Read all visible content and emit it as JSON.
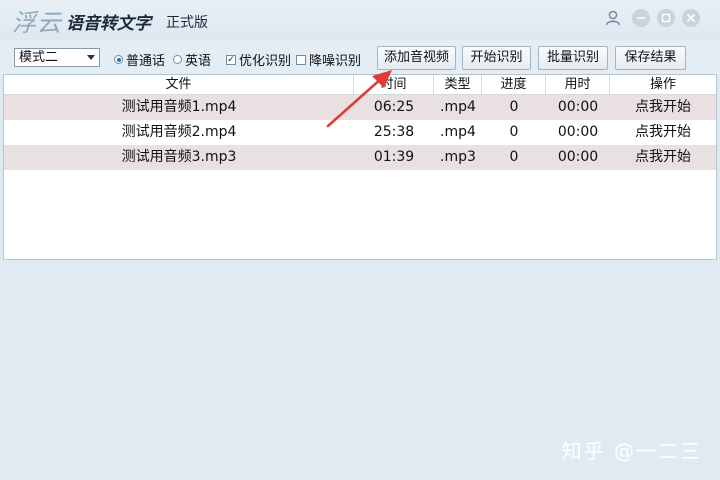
{
  "titlebar": {
    "logo": "浮云",
    "app_title": "语音转文字",
    "edition": "正式版"
  },
  "toolbar": {
    "mode_selected": "模式二",
    "radio_mandarin": "普通话",
    "radio_english": "英语",
    "check_optimize": "优化识别",
    "check_denoise": "降噪识别",
    "btn_add": "添加音视频",
    "btn_start": "开始识别",
    "btn_batch": "批量识别",
    "btn_save": "保存结果"
  },
  "table": {
    "columns": [
      "文件",
      "时间",
      "类型",
      "进度",
      "用时",
      "操作"
    ],
    "rows": [
      {
        "file": "测试用音频1.mp4",
        "time": "06:25",
        "type": ".mp4",
        "progress": "0",
        "elapsed": "00:00",
        "action": "点我开始"
      },
      {
        "file": "测试用音频2.mp4",
        "time": "25:38",
        "type": ".mp4",
        "progress": "0",
        "elapsed": "00:00",
        "action": "点我开始"
      },
      {
        "file": "测试用音频3.mp3",
        "time": "01:39",
        "type": ".mp3",
        "progress": "0",
        "elapsed": "00:00",
        "action": "点我开始"
      }
    ]
  },
  "watermark": "知乎 @一二三",
  "colors": {
    "arrow": "#e23b35",
    "row_shade": "#e8e0e1",
    "radio_on": "#1f6fd1"
  }
}
